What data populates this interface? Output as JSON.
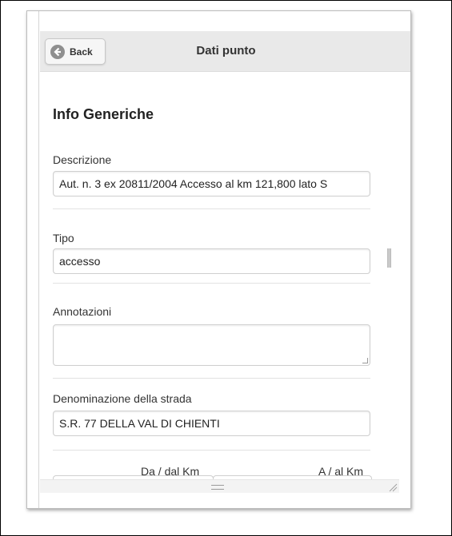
{
  "header": {
    "back_label": "Back",
    "title": "Dati punto"
  },
  "section": {
    "title": "Info Generiche"
  },
  "fields": {
    "descrizione": {
      "label": "Descrizione",
      "value": "Aut. n. 3 ex 20811/2004 Accesso al km 121,800 lato S"
    },
    "tipo": {
      "label": "Tipo",
      "value": "accesso"
    },
    "annotazioni": {
      "label": "Annotazioni",
      "value": ""
    },
    "strada": {
      "label": "Denominazione della strada",
      "value": "S.R. 77 DELLA VAL DI CHIENTI"
    }
  },
  "km": {
    "from_label": "Da / dal Km",
    "to_label": "A / al Km"
  },
  "icons": {
    "back": "back-arrow-circle-icon",
    "drag": "drag-handle-icon",
    "resize": "resize-grip-icon"
  }
}
